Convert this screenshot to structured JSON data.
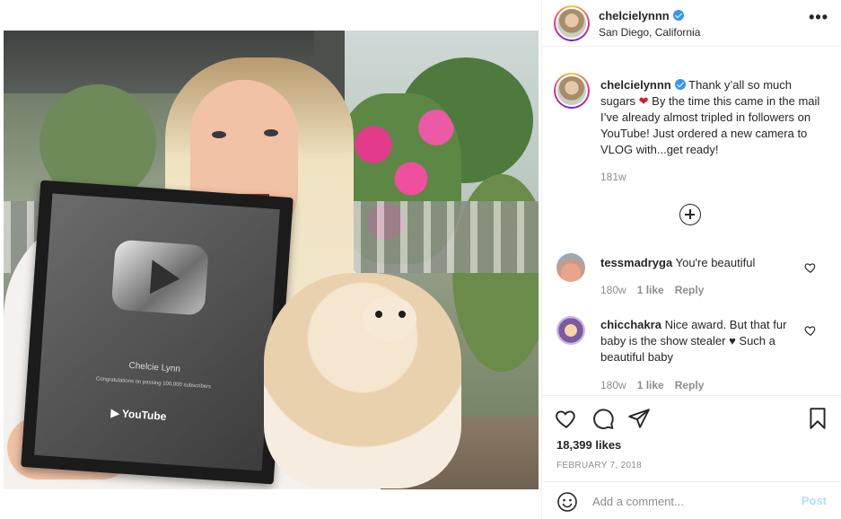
{
  "post": {
    "username": "chelcielynnn",
    "location": "San Diego, California",
    "more_glyph": "•••",
    "caption_pre": "Thank y’all so much sugars ",
    "caption_emoji": "❤",
    "caption_post": " By the time this came in the mail I’ve already almost tripled in followers on YouTube! Just ordered a new camera to VLOG with...get ready!",
    "age": "181w",
    "media_text": {
      "plaque_name": "Chelcie Lynn",
      "plaque_congrats": "Congratulations on passing 100,000 subscribers",
      "plaque_brand": "▶ YouTube"
    }
  },
  "comments": [
    {
      "username": "tessmadryga",
      "text": "You're beautiful",
      "age": "180w",
      "likes": "1 like",
      "reply": "Reply"
    },
    {
      "username": "chicchakra",
      "text": "Nice award. But that fur baby is the show stealer ♥ Such a beautiful baby",
      "age": "180w",
      "likes": "1 like",
      "reply": "Reply"
    }
  ],
  "actions": {
    "likes": "18,399 likes",
    "date": "FEBRUARY 7, 2018"
  },
  "comment_bar": {
    "placeholder": "Add a comment...",
    "post_label": "Post"
  },
  "icons": [
    "verified-badge-icon",
    "more-options-icon",
    "load-more-comments-icon",
    "heart-icon",
    "comment-icon",
    "share-icon",
    "bookmark-icon",
    "emoji-icon"
  ],
  "colors": {
    "verified": "#3897f0",
    "muted": "#8e8e8e",
    "post_button_disabled": "#b2dffc",
    "heart_emoji": "#d11d2b"
  }
}
